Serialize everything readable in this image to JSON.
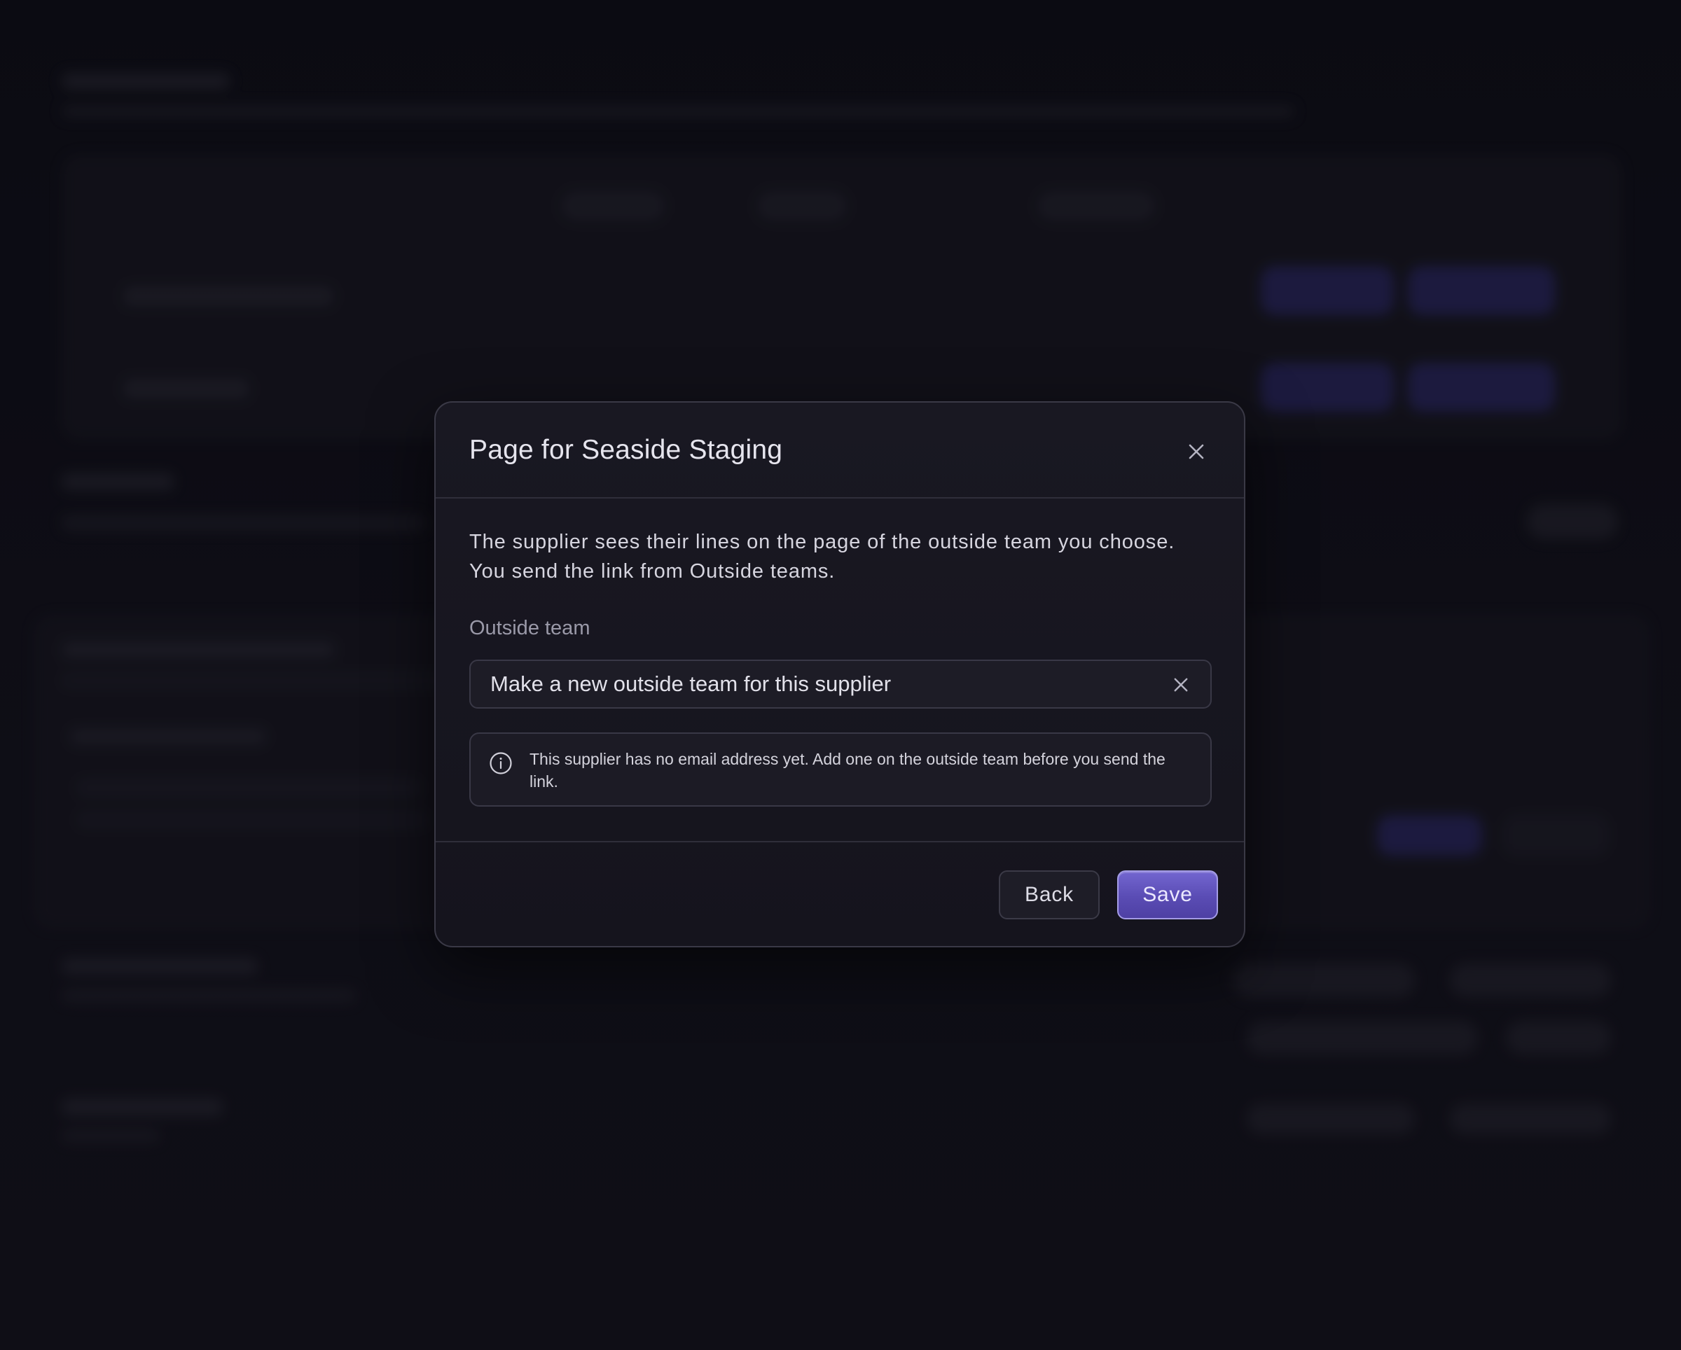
{
  "modal": {
    "title": "Page for Seaside Staging",
    "description_line1": "The supplier sees their lines on the page of the outside team you choose.",
    "description_line2": "You send the link from Outside teams.",
    "field_label": "Outside team",
    "select_value": "Make a new outside team for this supplier",
    "notice_text": "This supplier has no email address yet. Add one on the outside team before you send the link.",
    "back_label": "Back",
    "save_label": "Save"
  },
  "icons": {
    "close": "close-icon",
    "clear": "clear-icon",
    "info": "info-icon"
  },
  "colors": {
    "accent": "#6457c4",
    "background": "#0e0e17",
    "modal": "#181721"
  }
}
